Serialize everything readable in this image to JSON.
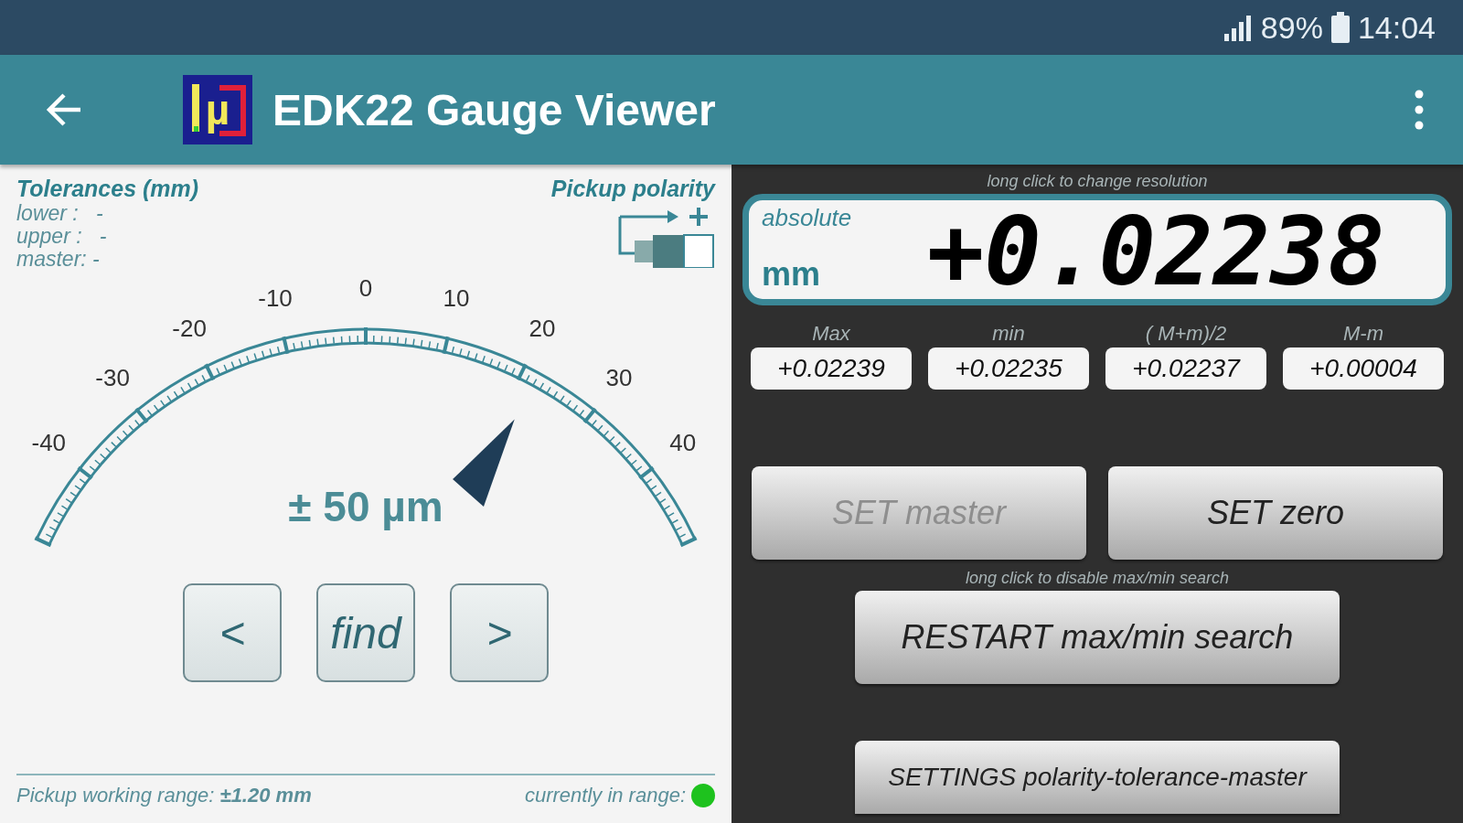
{
  "status_bar": {
    "battery": "89%",
    "time": "14:04"
  },
  "app_bar": {
    "logo_text": "µ",
    "title": "EDK22 Gauge Viewer"
  },
  "tolerances": {
    "title": "Tolerances (mm)",
    "lines": [
      "lower :   -",
      "upper :   -",
      "master: -"
    ]
  },
  "polarity": {
    "title": "Pickup polarity"
  },
  "gauge": {
    "tick_labels": [
      "-40",
      "-30",
      "-20",
      "-10",
      "0",
      "10",
      "20",
      "30",
      "40"
    ],
    "range": "± 50 µm"
  },
  "nav_buttons": [
    "<",
    "find",
    ">"
  ],
  "footer": {
    "range_text": "Pickup working range: **±1.20 mm**",
    "in_range_label": "currently in range:",
    "in_range": true
  },
  "resolution_hint": "long click to change resolution",
  "display": {
    "mode": "absolute",
    "unit": "mm",
    "value": "+0.02238"
  },
  "stats": [
    {
      "label": "Max",
      "value": "+0.02239"
    },
    {
      "label": "min",
      "value": "+0.02235"
    },
    {
      "label": "( M+m)/2",
      "value": "+0.02237"
    },
    {
      "label": "M-m",
      "value": "+0.00004"
    }
  ],
  "set_buttons": [
    {
      "label": "SET master",
      "disabled": true
    },
    {
      "label": "SET zero",
      "disabled": false
    }
  ],
  "search_hint": "long click to disable max/min search",
  "restart_button": "RESTART max/min search",
  "settings_button": "SETTINGS polarity-tolerance-master"
}
